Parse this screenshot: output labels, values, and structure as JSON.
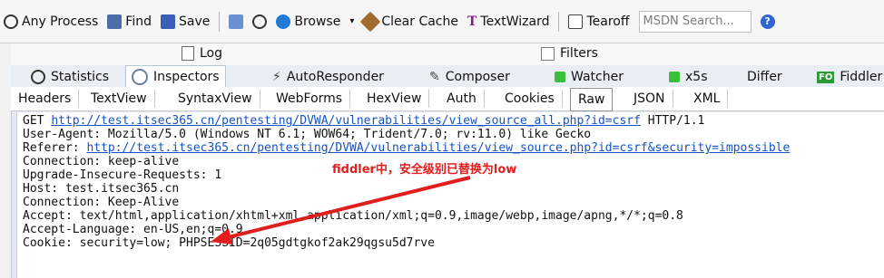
{
  "toolbar": {
    "any_process": "Any Process",
    "find": "Find",
    "save": "Save",
    "browse": "Browse",
    "clear_cache": "Clear Cache",
    "textwizard": "TextWizard",
    "tearoff": "Tearoff",
    "msdn_placeholder": "MSDN Search...",
    "icons": [
      "crosshair-icon",
      "binoculars-icon",
      "save-icon",
      "copy-icon",
      "timer-icon",
      "ie-icon",
      "broom-icon",
      "text-icon",
      "tearoff-icon",
      "help-icon"
    ]
  },
  "log_row": {
    "log": "Log",
    "filters": "Filters"
  },
  "tabs": [
    {
      "label": "Statistics"
    },
    {
      "label": "Inspectors"
    },
    {
      "label": "AutoResponder"
    },
    {
      "label": "Composer"
    },
    {
      "label": "Watcher"
    },
    {
      "label": "x5s"
    },
    {
      "label": "Differ"
    },
    {
      "label": "Fiddler"
    }
  ],
  "subtabs": [
    {
      "label": "Headers"
    },
    {
      "label": "TextView"
    },
    {
      "label": "SyntaxView"
    },
    {
      "label": "WebForms"
    },
    {
      "label": "HexView"
    },
    {
      "label": "Auth"
    },
    {
      "label": "Cookies"
    },
    {
      "label": "Raw"
    },
    {
      "label": "JSON"
    },
    {
      "label": "XML"
    }
  ],
  "request": {
    "get_prefix": "GET ",
    "get_url": "http://test.itsec365.cn/pentesting/DVWA/vulnerabilities/view_source_all.php?id=csrf",
    "get_suffix": " HTTP/1.1",
    "user_agent": "User-Agent: Mozilla/5.0 (Windows NT 6.1; WOW64; Trident/7.0; rv:11.0) like Gecko",
    "referer_prefix": "Referer: ",
    "referer_url": "http://test.itsec365.cn/pentesting/DVWA/vulnerabilities/view_source.php?id=csrf&security=impossible",
    "connection1": "Connection: keep-alive",
    "upgrade": "Upgrade-Insecure-Requests: 1",
    "host": "Host: test.itsec365.cn",
    "connection2": "Connection: Keep-Alive",
    "accept": "Accept: text/html,application/xhtml+xml,application/xml;q=0.9,image/webp,image/apng,*/*;q=0.8",
    "accept_language": "Accept-Language: en-US,en;q=0.9",
    "cookie": "Cookie: security=low; PHPSESSID=2q05gdtgkof2ak29qgsu5d7rve"
  },
  "annotation": {
    "text": "fiddler中，安全级别已替换为low",
    "color": "#e21d1d"
  },
  "colors": {
    "link": "#1553c7",
    "tab_bg": "#e9eef4",
    "annotation": "#e21d1d"
  }
}
